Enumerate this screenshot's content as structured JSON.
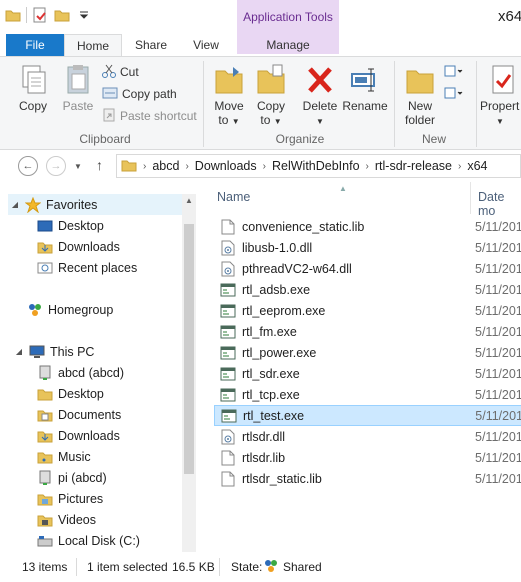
{
  "window": {
    "title": "x64"
  },
  "ribbon_tabs": {
    "file": "File",
    "home": "Home",
    "share": "Share",
    "view": "View",
    "context_group": "Application Tools",
    "manage": "Manage"
  },
  "ribbon": {
    "copy": "Copy",
    "paste": "Paste",
    "cut": "Cut",
    "copy_path": "Copy path",
    "paste_shortcut": "Paste shortcut",
    "clipboard_group": "Clipboard",
    "move_to_1": "Move",
    "move_to_2": "to",
    "copy_to_1": "Copy",
    "copy_to_2": "to",
    "delete": "Delete",
    "rename": "Rename",
    "organize_group": "Organize",
    "new_folder_1": "New",
    "new_folder_2": "folder",
    "new_group": "New",
    "properties": "Propert"
  },
  "address": {
    "crumbs": [
      "abcd",
      "Downloads",
      "RelWithDebInfo",
      "rtl-sdr-release",
      "x64"
    ]
  },
  "nav": {
    "favorites": "Favorites",
    "desktop": "Desktop",
    "downloads": "Downloads",
    "recent": "Recent places",
    "homegroup": "Homegroup",
    "this_pc": "This PC",
    "abcd": "abcd (abcd)",
    "pc_desktop": "Desktop",
    "documents": "Documents",
    "pc_downloads": "Downloads",
    "music": "Music",
    "pi": "pi (abcd)",
    "pictures": "Pictures",
    "videos": "Videos",
    "local_disk": "Local Disk (C:)"
  },
  "columns": {
    "name": "Name",
    "date": "Date mo"
  },
  "files": [
    {
      "name": "convenience_static.lib",
      "date": "5/11/201",
      "icon": "file-icon"
    },
    {
      "name": "libusb-1.0.dll",
      "date": "5/11/201",
      "icon": "dll-icon"
    },
    {
      "name": "pthreadVC2-w64.dll",
      "date": "5/11/201",
      "icon": "dll-icon"
    },
    {
      "name": "rtl_adsb.exe",
      "date": "5/11/201",
      "icon": "exe-icon"
    },
    {
      "name": "rtl_eeprom.exe",
      "date": "5/11/201",
      "icon": "exe-icon"
    },
    {
      "name": "rtl_fm.exe",
      "date": "5/11/201",
      "icon": "exe-icon"
    },
    {
      "name": "rtl_power.exe",
      "date": "5/11/201",
      "icon": "exe-icon"
    },
    {
      "name": "rtl_sdr.exe",
      "date": "5/11/201",
      "icon": "exe-icon"
    },
    {
      "name": "rtl_tcp.exe",
      "date": "5/11/201",
      "icon": "exe-icon"
    },
    {
      "name": "rtl_test.exe",
      "date": "5/11/201",
      "icon": "exe-icon"
    },
    {
      "name": "rtlsdr.dll",
      "date": "5/11/201",
      "icon": "dll-icon"
    },
    {
      "name": "rtlsdr.lib",
      "date": "5/11/201",
      "icon": "file-icon"
    },
    {
      "name": "rtlsdr_static.lib",
      "date": "5/11/201",
      "icon": "file-icon"
    }
  ],
  "selected_index": 9,
  "status": {
    "items": "13 items",
    "selected": "1 item selected",
    "size": "16.5 KB",
    "state_label": "State:",
    "state_value": "Shared"
  }
}
